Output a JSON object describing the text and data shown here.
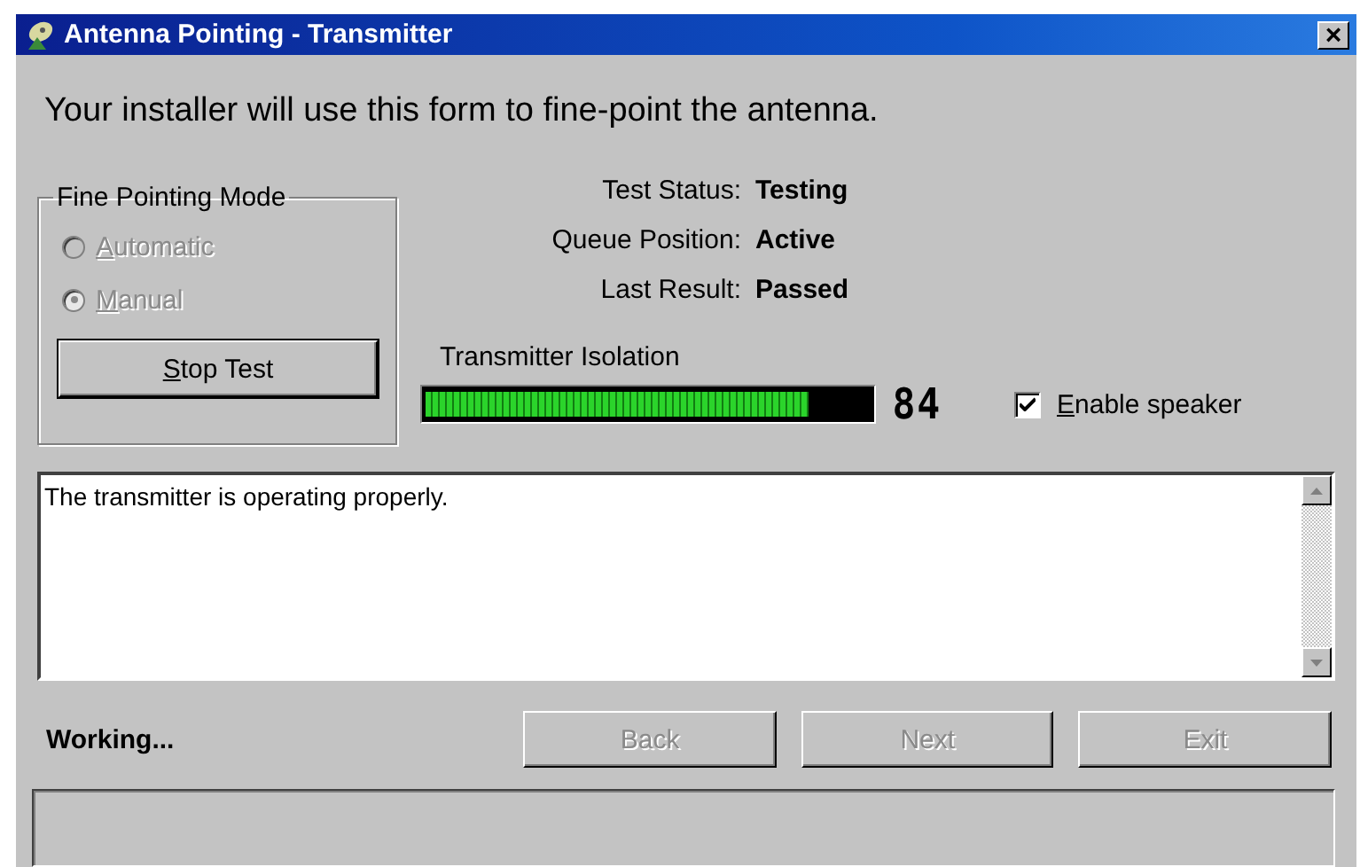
{
  "window": {
    "title": "Antenna Pointing - Transmitter",
    "close": "×"
  },
  "intro": "Your installer will use this form to fine-point the antenna.",
  "mode_group": {
    "title": "Fine Pointing Mode",
    "options": [
      {
        "label": "Automatic",
        "selected": false,
        "disabled": true
      },
      {
        "label": "Manual",
        "selected": true,
        "disabled": true
      }
    ],
    "button": {
      "label": "Stop Test",
      "disabled": false
    }
  },
  "status": [
    {
      "label": "Test Status:",
      "value": "Testing"
    },
    {
      "label": "Queue Position:",
      "value": "Active"
    },
    {
      "label": "Last Result:",
      "value": "Passed"
    }
  ],
  "isolation": {
    "label": "Transmitter Isolation",
    "level": 0.86,
    "reading": "84"
  },
  "speaker": {
    "label": "Enable speaker",
    "checked": true
  },
  "message": "The transmitter is operating properly.",
  "status_text": "Working...",
  "buttons": [
    {
      "label": "Back",
      "disabled": true
    },
    {
      "label": "Next",
      "disabled": true
    },
    {
      "label": "Exit",
      "disabled": true
    }
  ]
}
